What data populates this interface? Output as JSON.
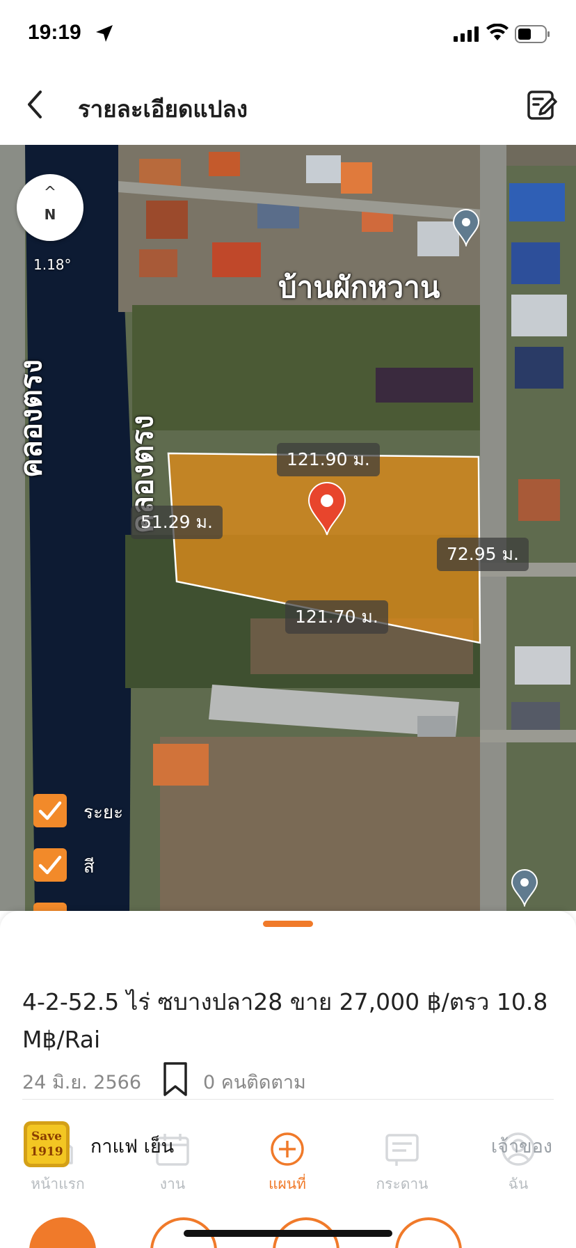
{
  "status_bar": {
    "time": "19:19"
  },
  "header": {
    "title": "รายละเอียดแปลง"
  },
  "map": {
    "compass_arrow": "^",
    "compass_letter": "N",
    "compass_angle": "1.18°",
    "area_label": "บ้านผักหวาน",
    "canal_labels": [
      "คลองตรง",
      "คลองตรง"
    ],
    "dimensions": [
      "121.90 ม.",
      "51.29 ม.",
      "72.95 ม.",
      "121.70 ม."
    ],
    "toggles": [
      "ระยะ",
      "สี"
    ],
    "colors": {
      "plot_fill": "#d88a1c",
      "pin": "#e8452c",
      "toggle": "#f28a2a"
    }
  },
  "listing": {
    "title": "4-2-52.5 ไร่ ซบางปลา28 ขาย 27,000 ฿/ตรว 10.8 M฿/Rai",
    "date": "24 มิ.ย. 2566",
    "followers": "0 คนติดตาม"
  },
  "owner": {
    "avatar_text": "Save 1919",
    "name": "กาแฟ เย็น",
    "role": "เจ้าของ"
  },
  "tabs": [
    {
      "label": "หน้าแรก",
      "icon": "home-icon"
    },
    {
      "label": "งาน",
      "icon": "calendar-icon"
    },
    {
      "label": "แผนที่",
      "icon": "plus-circle-icon",
      "active": true
    },
    {
      "label": "กระดาน",
      "icon": "board-icon"
    },
    {
      "label": "ฉัน",
      "icon": "profile-icon"
    }
  ],
  "accent_color": "#f07a2a"
}
